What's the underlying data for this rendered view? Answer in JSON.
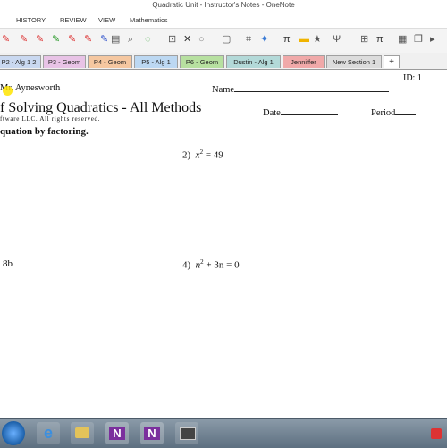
{
  "window": {
    "title": "Quadratic Unit - Instructor's Notes - OneNote"
  },
  "ribbon_tabs": [
    "HISTORY",
    "REVIEW",
    "VIEW",
    "Mathematics"
  ],
  "section_tabs": [
    {
      "label": "P2 - Alg 1 2",
      "color": "#c9d8f0"
    },
    {
      "label": "P3 - Geom",
      "color": "#e8c3e6"
    },
    {
      "label": "P4 - Geom",
      "color": "#f5c7a0"
    },
    {
      "label": "P5 - Alg 1",
      "color": "#bcd8f2"
    },
    {
      "label": "P6 - Geom",
      "color": "#b7e0a0"
    },
    {
      "label": "Dustin - Alg 1",
      "color": "#b3d9d8"
    },
    {
      "label": "Jenniffer",
      "color": "#f0a9a9"
    },
    {
      "label": "New Section 1",
      "color": "#dcdcdc"
    },
    {
      "label": "+",
      "color": "#ffffff"
    }
  ],
  "toolbar_icons": [
    "pen-red-icon",
    "pen-red-icon",
    "pen-red-icon",
    "pen-green-icon",
    "pen-red-icon",
    "pen-red-icon",
    "pen-blue-icon",
    "pen-red-icon",
    "printer-icon",
    "preview-icon",
    "lasso-icon",
    "insert-icon",
    "close-x-icon",
    "eraser-circle-icon",
    "shape-icon",
    "crop-icon",
    "color-icon",
    "pi-icon",
    "highlight-icon",
    "star-icon",
    "wand-icon",
    "grid-icon",
    "pi-icon",
    "table-icon",
    "copy-icon"
  ],
  "worksheet": {
    "teacher": "Mr. Aynesworth",
    "id_label": "ID: 1",
    "name_label": "Name",
    "title": "f Solving Quadratics - All Methods",
    "copyright": "ftware LLC.  All rights reserved.",
    "date_label": "Date",
    "period_label": "Period",
    "instruction": "quation by factoring.",
    "problem2_num": "2)",
    "problem2_lhs": "x",
    "problem2_exp": "2",
    "problem2_rhs": " = 49",
    "problem3_fragment": "8b",
    "problem4_num": "4)",
    "problem4_var": "n",
    "problem4_exp": "2",
    "problem4_rest": " + 3n = 0"
  },
  "taskbar_apps": [
    "start-orb-icon",
    "ie-icon",
    "file-explorer-icon",
    "onenote-icon",
    "onenote-icon",
    "media-icon"
  ]
}
